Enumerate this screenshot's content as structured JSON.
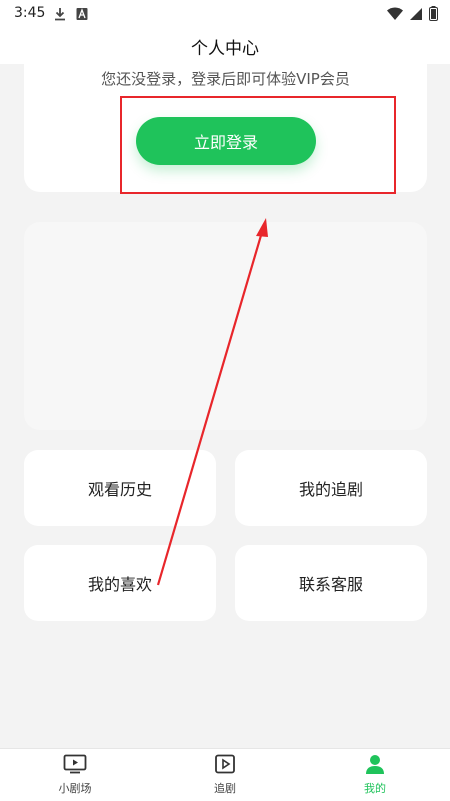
{
  "status_bar": {
    "time": "3:45",
    "left_icons": [
      "download-icon",
      "font-a-icon"
    ],
    "right_icons": [
      "wifi-icon",
      "signal-icon",
      "battery-icon"
    ]
  },
  "header": {
    "title": "个人中心"
  },
  "login_card": {
    "hint": "您还没登录，登录后即可体验VIP会员",
    "login_button_label": "立即登录"
  },
  "menu": {
    "items": [
      {
        "label": "观看历史"
      },
      {
        "label": "我的追剧"
      },
      {
        "label": "我的喜欢"
      },
      {
        "label": "联系客服"
      }
    ]
  },
  "bottom_nav": {
    "items": [
      {
        "label": "小剧场",
        "icon": "tv-icon"
      },
      {
        "label": "追剧",
        "icon": "play-square-icon"
      },
      {
        "label": "我的",
        "icon": "person-icon",
        "active": true
      }
    ]
  },
  "colors": {
    "accent": "#1fc35b",
    "annotation": "#e8262b",
    "background": "#f3f3f3"
  }
}
